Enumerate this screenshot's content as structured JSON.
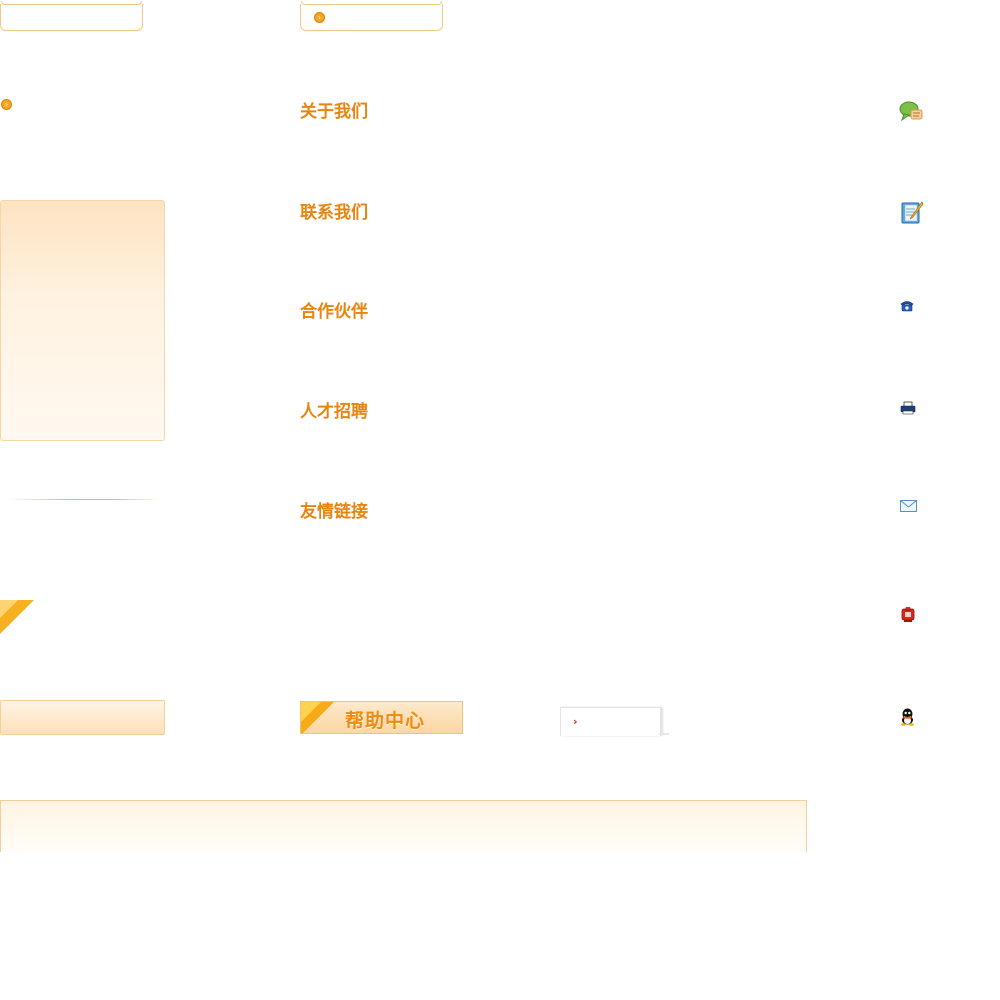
{
  "tabs": {
    "left_label": "",
    "right_bullet": "›"
  },
  "sidebar_bullet": "›",
  "nav": {
    "items": [
      {
        "label": "关于我们"
      },
      {
        "label": "联系我们"
      },
      {
        "label": "合作伙伴"
      },
      {
        "label": "人才招聘"
      },
      {
        "label": "友情链接"
      }
    ]
  },
  "help_button": {
    "label": "帮助中心"
  },
  "mini_box": {
    "arrow": "›"
  },
  "icons": [
    {
      "name": "comment-icon"
    },
    {
      "name": "notepad-icon"
    },
    {
      "name": "phone-icon"
    },
    {
      "name": "fax-icon"
    },
    {
      "name": "mail-icon"
    },
    {
      "name": "mobile-icon"
    },
    {
      "name": "qq-icon"
    }
  ],
  "colors": {
    "accent": "#e8850e",
    "border": "#f2c98a",
    "bullet": "#f5a623"
  }
}
